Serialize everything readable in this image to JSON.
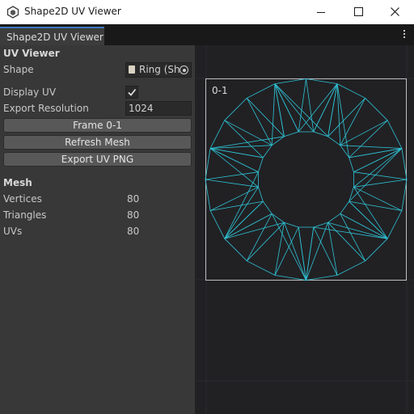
{
  "window": {
    "title": "Shape2D UV Viewer",
    "minimize_icon": "minimize-icon",
    "maximize_icon": "maximize-icon",
    "close_icon": "close-icon"
  },
  "tab": {
    "label": "Shape2D UV Viewer",
    "menu_icon": "kebab-menu-icon"
  },
  "inspector": {
    "section_title": "UV Viewer",
    "shape": {
      "label": "Shape",
      "value": "Ring (Sh",
      "icon": "asset-icon",
      "picker_icon": "object-picker-icon"
    },
    "display_uv": {
      "label": "Display UV",
      "checked": true
    },
    "export_resolution": {
      "label": "Export Resolution",
      "value": "1024"
    },
    "buttons": {
      "frame": "Frame 0-1",
      "refresh": "Refresh Mesh",
      "export": "Export UV PNG"
    },
    "mesh": {
      "title": "Mesh",
      "vertices": {
        "label": "Vertices",
        "value": "80"
      },
      "triangles": {
        "label": "Triangles",
        "value": "80"
      },
      "uvs": {
        "label": "UVs",
        "value": "80"
      }
    }
  },
  "viewer": {
    "frame_label": "0-1",
    "wire_color": "#2ec4d6",
    "uv_ring": {
      "outer_radius": 0.5,
      "inner_radius": 0.24,
      "segments": 20
    }
  },
  "colors": {
    "panel": "#383838",
    "viewer_bg": "#212124",
    "accent": "#3a79bb"
  }
}
